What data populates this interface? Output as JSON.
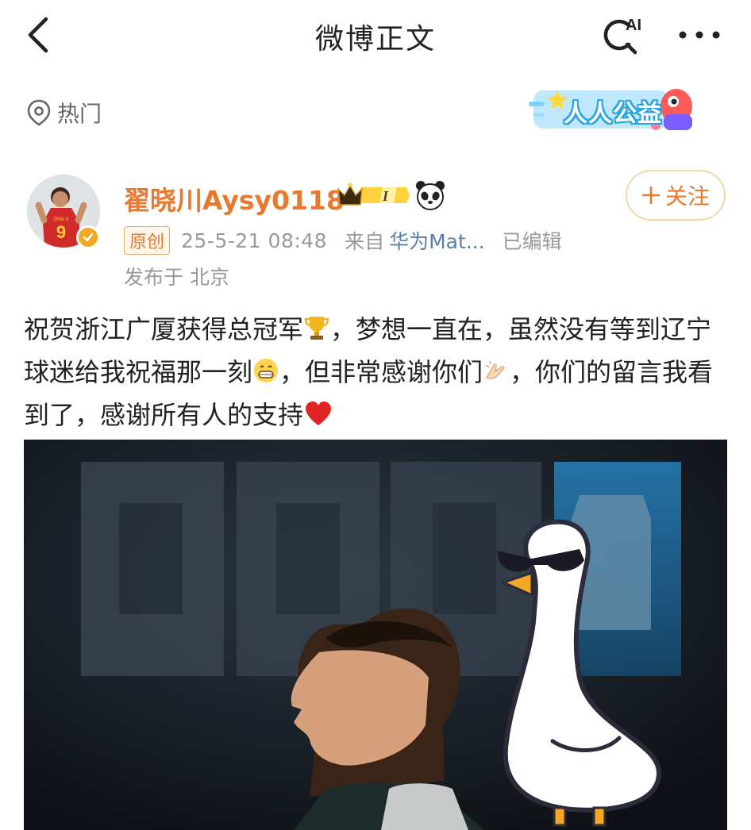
{
  "header": {
    "title": "微博正文",
    "ai_label": "AI"
  },
  "tag": {
    "hot_label": "热门"
  },
  "charity": {
    "label": "人人公益"
  },
  "user": {
    "name": "翟晓川Aysy0118",
    "level_label": "I",
    "jersey_name": "ZHAI X",
    "jersey_number": "9"
  },
  "follow": {
    "label": "关注"
  },
  "meta": {
    "original_tag": "原创",
    "time": "25-5-21 08:48",
    "from_label": "来自",
    "device": "华为Mat...",
    "edited": "已编辑",
    "location": "发布于 北京"
  },
  "post": {
    "text_1": "祝贺浙江广厦获得总冠军",
    "text_2": "，梦想一直在，虽然没有等到辽宁球迷给我祝福那一刻",
    "text_3": "，但非常感谢你们",
    "text_4": "，你们的留言我看到了，感谢所有人的支持"
  },
  "colors": {
    "accent_orange": "#e8792f",
    "follow_border": "#f2d7a8",
    "meta_gray": "#999999",
    "link_blue": "#5a7fa8",
    "charity_blue": "#2aa3e3"
  },
  "icons": [
    "back-icon",
    "ai-search-icon",
    "more-icon",
    "hot-location-icon",
    "crown-icon",
    "panda-icon",
    "plus-icon",
    "trophy-emoji",
    "grin-emoji",
    "pray-emoji",
    "heart-emoji",
    "sunglasses-goose-sticker"
  ]
}
